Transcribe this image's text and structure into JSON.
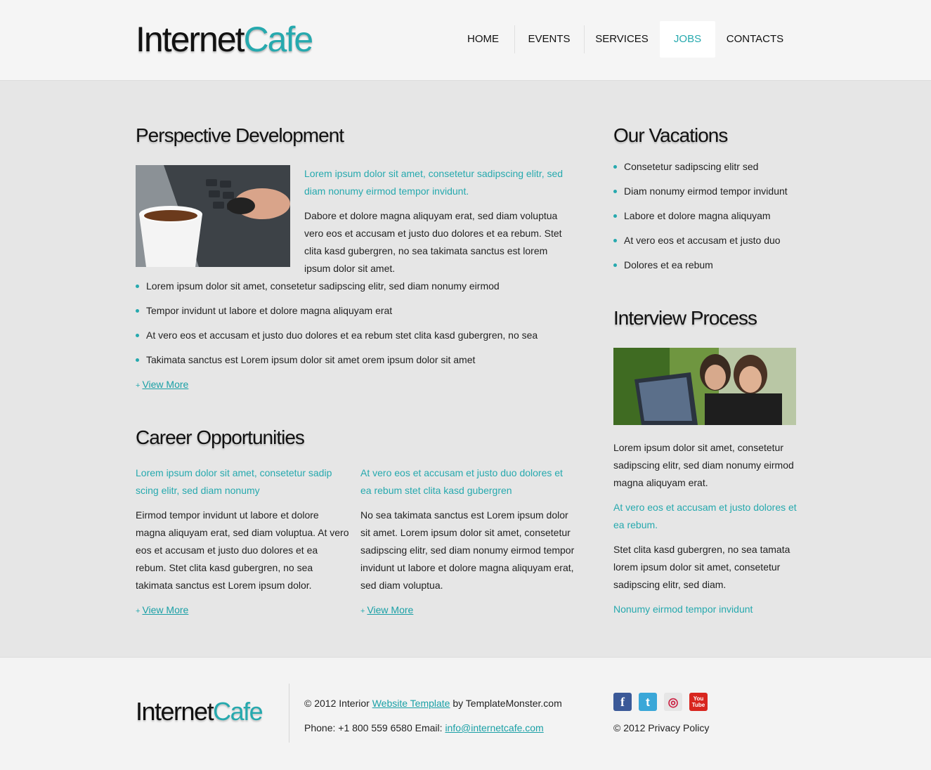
{
  "header": {
    "logo_part1": "Internet",
    "logo_part2": "Cafe",
    "nav": [
      {
        "label": "HOME"
      },
      {
        "label": "EVENTS"
      },
      {
        "label": "SERVICES"
      },
      {
        "label": "JOBS",
        "active": true
      },
      {
        "label": "CONTACTS"
      }
    ]
  },
  "perspective": {
    "title": "Perspective Development",
    "lead": "Lorem ipsum dolor sit amet, consetetur sadipscing elitr, sed diam nonumy eirmod tempor invidunt.",
    "body": "Dabore et dolore magna aliquyam erat, sed diam voluptua vero eos et accusam et justo duo dolores et ea rebum. Stet clita kasd gubergren, no sea takimata sanctus est lorem ipsum dolor sit amet.",
    "bullets": [
      "Lorem ipsum dolor sit amet, consetetur sadipscing elitr, sed diam nonumy eirmod",
      "Tempor invidunt ut labore et dolore magna aliquyam erat",
      "At vero eos et accusam et justo duo dolores et ea rebum stet clita kasd gubergren, no sea",
      "Takimata sanctus est Lorem ipsum dolor sit amet orem ipsum dolor sit amet"
    ],
    "view_more": "View More"
  },
  "career": {
    "title": "Career Opportunities",
    "col1_lead": "Lorem ipsum dolor sit amet, consetetur sadip scing elitr, sed diam nonumy",
    "col1_body": "Eirmod tempor invidunt ut labore et dolore magna aliquyam erat, sed diam voluptua. At vero eos et accusam et justo duo dolores et ea rebum. Stet clita kasd gubergren, no sea takimata sanctus est Lorem ipsum dolor.",
    "col2_lead": "At vero eos et accusam et justo duo dolores et ea rebum stet clita kasd gubergren",
    "col2_body": "No sea takimata sanctus est Lorem ipsum dolor sit amet. Lorem ipsum dolor sit amet, consetetur sadipscing elitr, sed diam nonumy eirmod tempor invidunt ut labore et dolore magna aliquyam erat, sed diam voluptua.",
    "view_more": "View More"
  },
  "vacations": {
    "title": "Our Vacations",
    "items": [
      "Consetetur sadipscing elitr sed",
      "Diam nonumy eirmod tempor invidunt",
      "Labore et dolore magna aliquyam",
      "At vero eos et accusam et justo duo",
      "Dolores et ea rebum"
    ]
  },
  "interview": {
    "title": "Interview Process",
    "p1": "Lorem ipsum dolor sit amet, consetetur sadipscing elitr, sed diam nonumy eirmod magna aliquyam erat.",
    "p2": "At vero eos et accusam et justo dolores et ea rebum.",
    "p3": "Stet clita kasd gubergren, no sea tamata lorem ipsum dolor sit amet, consetetur sadipscing elitr, sed diam.",
    "p4": "Nonumy eirmod tempor invidunt"
  },
  "footer": {
    "logo_part1": "Internet",
    "logo_part2": "Cafe",
    "copy_prefix": "© 2012 Interior ",
    "copy_link": "Website Template",
    "copy_suffix": " by TemplateMonster.com",
    "phone_text": "Phone: +1 800 559 6580 Email: ",
    "email": "info@internetcafe.com",
    "privacy": "© 2012 Privacy Policy",
    "social": [
      {
        "icon": "facebook-icon",
        "glyph": "f",
        "color": "#3b5998"
      },
      {
        "icon": "twitter-icon",
        "glyph": "t",
        "color": "#3aa7d8"
      },
      {
        "icon": "picasa-icon",
        "glyph": "◎",
        "color": "#d9d9d9"
      },
      {
        "icon": "youtube-icon",
        "glyph": "You Tube",
        "color": "#d8261f"
      }
    ]
  },
  "colors": {
    "accent": "#26a9ae"
  }
}
